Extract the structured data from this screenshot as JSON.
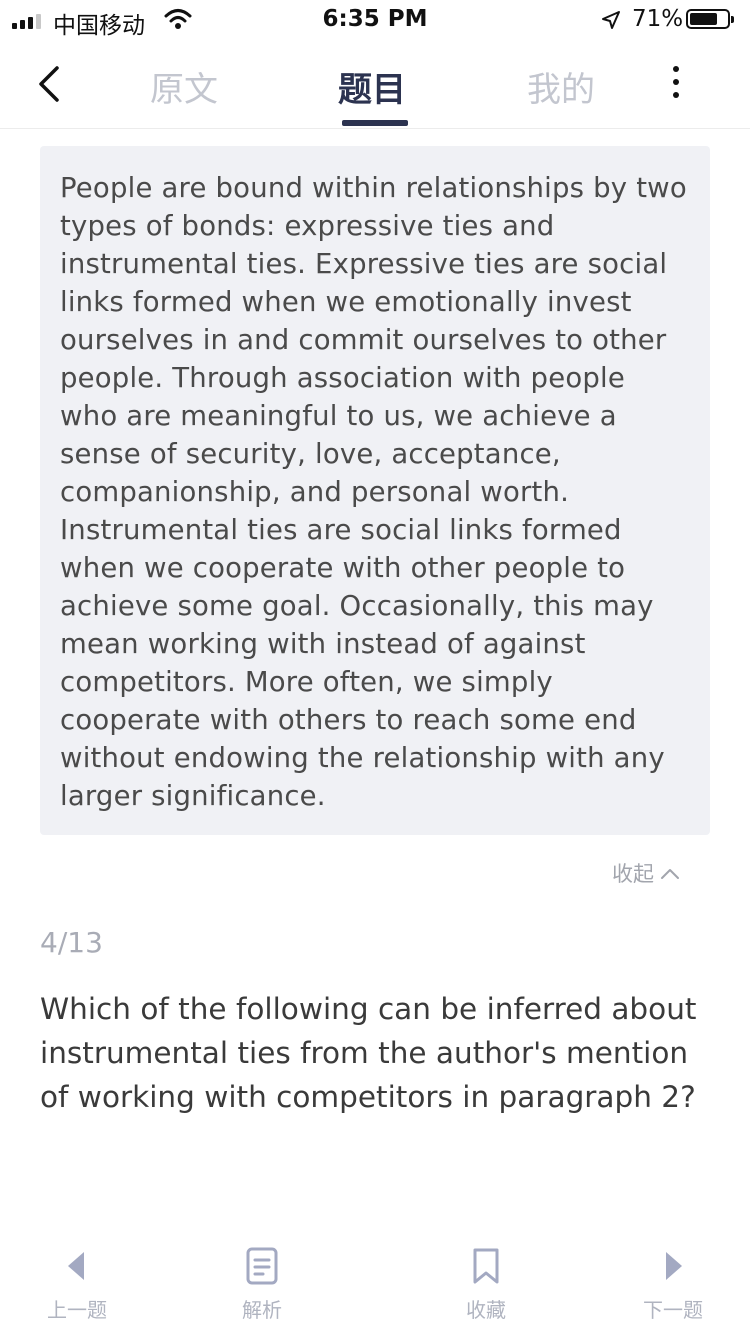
{
  "status_bar": {
    "carrier": "中国移动",
    "time": "6:35 PM",
    "battery_percent": "71%",
    "battery_level": 0.71
  },
  "nav": {
    "tabs": [
      {
        "label": "原文",
        "active": false
      },
      {
        "label": "题目",
        "active": true
      },
      {
        "label": "我的",
        "active": false
      }
    ],
    "icons": [
      "back-chevron-icon",
      "more-vertical-icon"
    ]
  },
  "passage": {
    "text": "People are bound within relationships by two types of bonds: expressive ties and instrumental ties. Expressive ties are social links formed when we emotionally invest ourselves in and commit ourselves to other people. Through association with people who are meaningful to us, we achieve a sense of security, love, acceptance, companionship, and personal worth. Instrumental ties are social links formed when we cooperate with other people to achieve some goal. Occasionally, this may mean working with instead of against competitors. More often, we simply cooperate with others to reach some end without endowing the relationship with any larger significance.",
    "collapse_label": "收起"
  },
  "question": {
    "counter": "4/13",
    "text": "Which of the following can be inferred about instrumental ties from the author's mention of working with competitors in paragraph 2?"
  },
  "bottom_bar": {
    "prev_label": "上一题",
    "analysis_label": "解析",
    "favorite_label": "收藏",
    "next_label": "下一题"
  },
  "colors": {
    "accent": "#2c3350",
    "inactive_tab": "#c3c6cf",
    "passage_bg": "#f0f1f5",
    "toolbar_icon": "#a3a9c2"
  }
}
